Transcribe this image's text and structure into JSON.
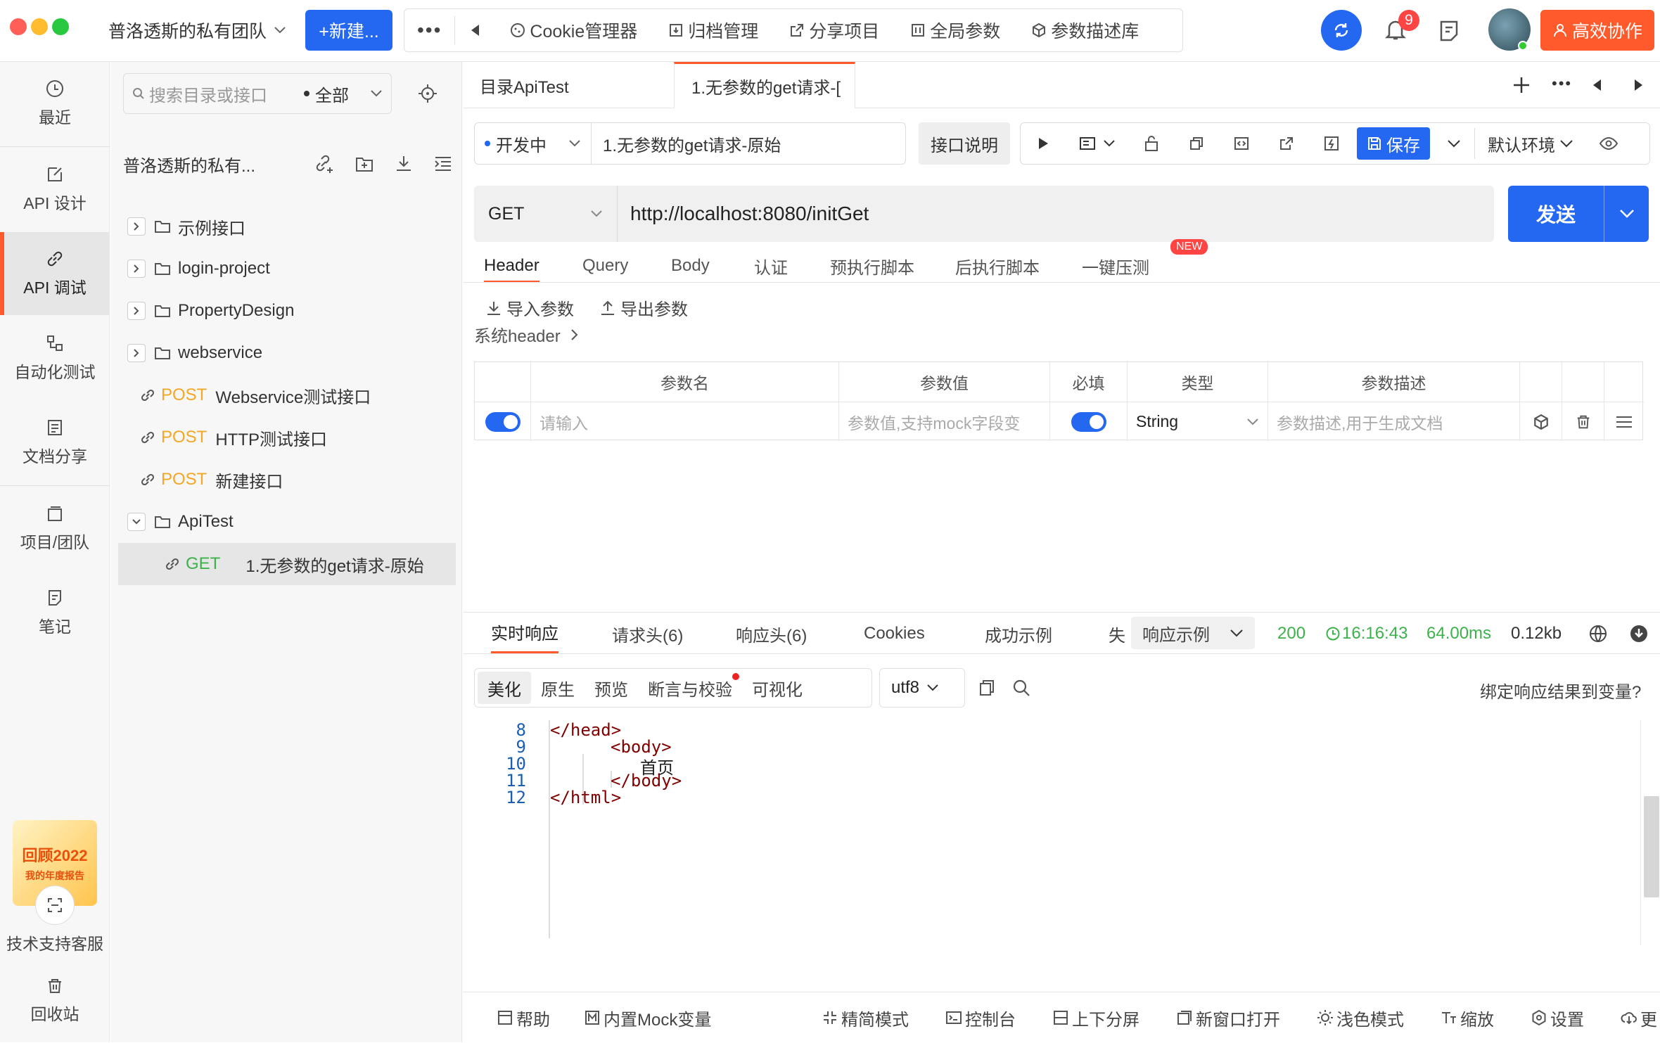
{
  "titlebar": {
    "team_name": "普洛透斯的私有团队",
    "new_button": "+新建...",
    "tools": [
      "Cookie管理器",
      "归档管理",
      "分享项目",
      "全局参数",
      "参数描述库"
    ],
    "notification_count": "9",
    "collab_button": "高效协作"
  },
  "leftnav": {
    "items": [
      "最近",
      "API 设计",
      "API 调试",
      "自动化测试",
      "文档分享",
      "项目/团队",
      "笔记"
    ],
    "promo_line1": "回顾2022",
    "promo_line2": "我的年度报告",
    "support": "技术支持客服",
    "recycle": "回收站"
  },
  "tree": {
    "search_placeholder": "搜索目录或接口",
    "filter": "全部",
    "project_name": "普洛透斯的私有...",
    "items": [
      {
        "type": "folder",
        "label": "示例接口"
      },
      {
        "type": "folder",
        "label": "login-project"
      },
      {
        "type": "folder",
        "label": "PropertyDesign"
      },
      {
        "type": "folder",
        "label": "webservice"
      },
      {
        "type": "api",
        "method": "POST",
        "label": "Webservice测试接口"
      },
      {
        "type": "api",
        "method": "POST",
        "label": "HTTP测试接口"
      },
      {
        "type": "api",
        "method": "POST",
        "label": "新建接口"
      },
      {
        "type": "folder",
        "label": "ApiTest"
      },
      {
        "type": "api",
        "method": "GET",
        "label": "1.无参数的get请求-原始"
      }
    ]
  },
  "tabs": [
    "目录ApiTest",
    "1.无参数的get请求-["
  ],
  "request": {
    "status": "开发中",
    "name": "1.无参数的get请求-原始",
    "doc_button": "接口说明",
    "save": "保存",
    "env": "默认环境",
    "method": "GET",
    "url": "http://localhost:8080/initGet",
    "send": "发送",
    "tabs": [
      "Header",
      "Query",
      "Body",
      "认证",
      "预执行脚本",
      "后执行脚本",
      "一键压测"
    ],
    "new_badge": "NEW",
    "import": "导入参数",
    "export": "导出参数",
    "system_header": "系统header"
  },
  "params": {
    "headers": [
      "参数名",
      "参数值",
      "必填",
      "类型",
      "参数描述"
    ],
    "name_placeholder": "请输入",
    "value_placeholder": "参数值,支持mock字段变",
    "type": "String",
    "desc_placeholder": "参数描述,用于生成文档"
  },
  "response": {
    "tabs": [
      "实时响应",
      "请求头(6)",
      "响应头(6)",
      "Cookies",
      "成功示例",
      "失"
    ],
    "example_select": "响应示例",
    "status_code": "200",
    "time": "16:16:43",
    "duration": "64.00ms",
    "size": "0.12kb",
    "views": [
      "美化",
      "原生",
      "预览",
      "断言与校验",
      "可视化"
    ],
    "encoding": "utf8",
    "bind_text": "绑定响应结果到变量?",
    "code_lines": [
      {
        "n": "8",
        "text": "</head>"
      },
      {
        "n": "9",
        "text": "<body>"
      },
      {
        "n": "10",
        "text": "首页"
      },
      {
        "n": "11",
        "text": "</body>"
      },
      {
        "n": "12",
        "text": "</html>"
      }
    ]
  },
  "bottombar": [
    "帮助",
    "内置Mock变量",
    "精简模式",
    "控制台",
    "上下分屏",
    "新窗口打开",
    "浅色模式",
    "缩放",
    "设置",
    "更"
  ]
}
